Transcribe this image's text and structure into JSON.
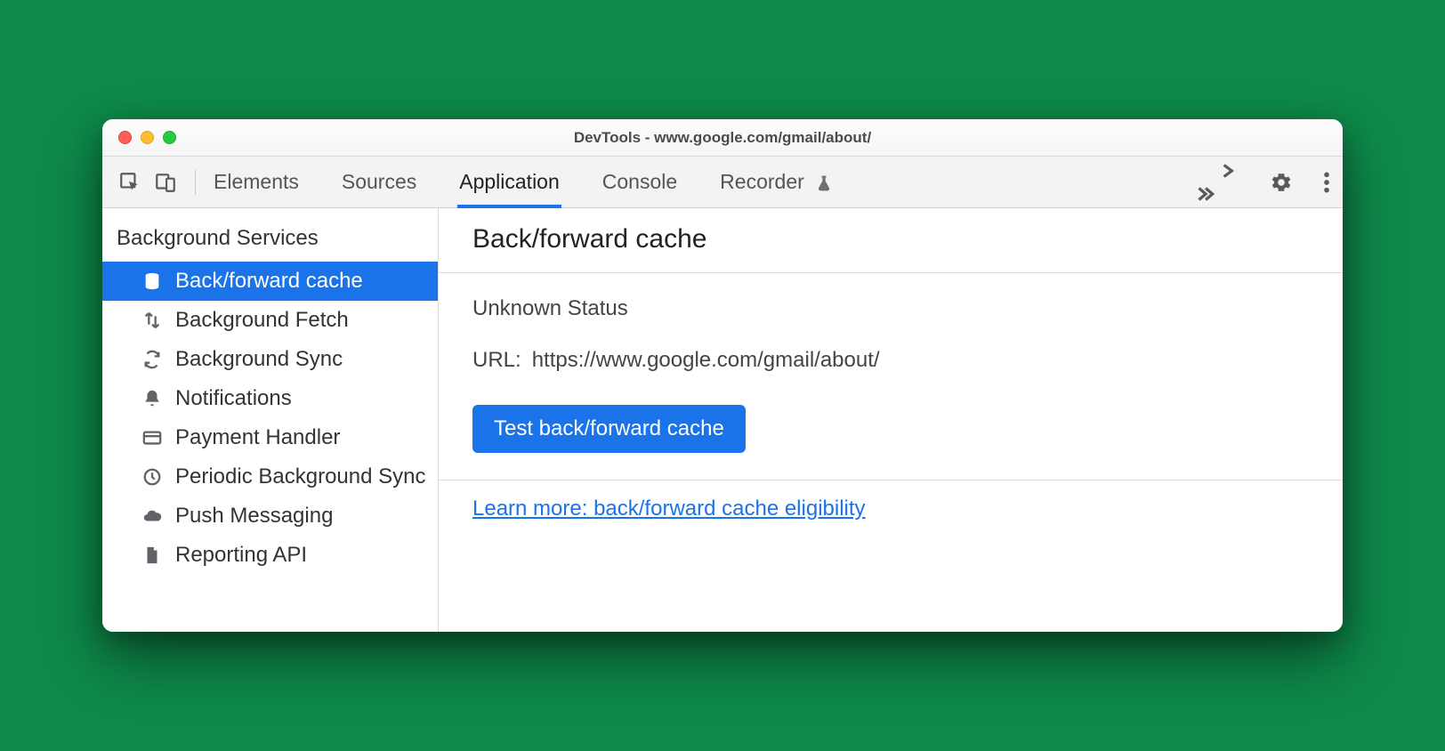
{
  "window": {
    "title": "DevTools - www.google.com/gmail/about/"
  },
  "toolbar": {
    "tabs": [
      "Elements",
      "Sources",
      "Application",
      "Console",
      "Recorder"
    ],
    "active_index": 2
  },
  "sidebar": {
    "section_title": "Background Services",
    "items": [
      {
        "label": "Back/forward cache",
        "icon": "database-icon",
        "selected": true
      },
      {
        "label": "Background Fetch",
        "icon": "transfer-icon",
        "selected": false
      },
      {
        "label": "Background Sync",
        "icon": "sync-icon",
        "selected": false
      },
      {
        "label": "Notifications",
        "icon": "bell-icon",
        "selected": false
      },
      {
        "label": "Payment Handler",
        "icon": "credit-card-icon",
        "selected": false
      },
      {
        "label": "Periodic Background Sync",
        "icon": "clock-icon",
        "selected": false
      },
      {
        "label": "Push Messaging",
        "icon": "cloud-icon",
        "selected": false
      },
      {
        "label": "Reporting API",
        "icon": "document-icon",
        "selected": false
      }
    ]
  },
  "panel": {
    "title": "Back/forward cache",
    "status": "Unknown Status",
    "url_label": "URL:",
    "url_value": "https://www.google.com/gmail/about/",
    "test_button": "Test back/forward cache",
    "learn_more": "Learn more: back/forward cache eligibility"
  }
}
